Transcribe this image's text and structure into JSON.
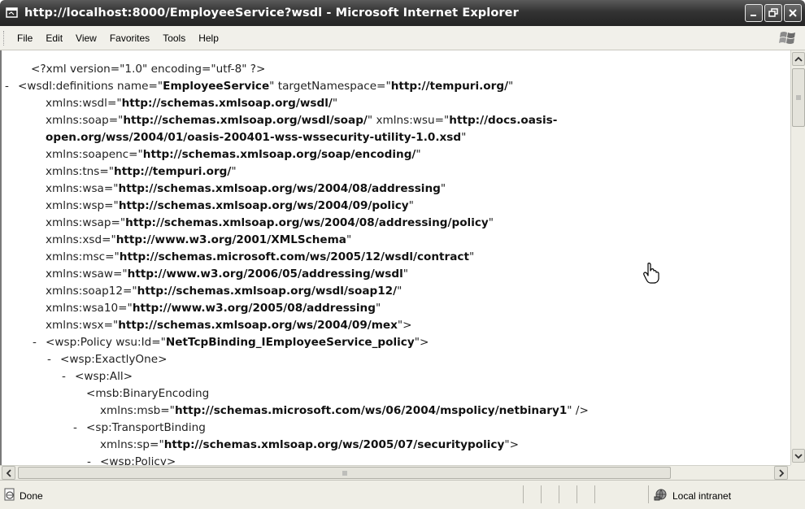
{
  "window": {
    "title": "http://localhost:8000/EmployeeService?wsdl - Microsoft Internet Explorer"
  },
  "menu": {
    "items": [
      "File",
      "Edit",
      "View",
      "Favorites",
      "Tools",
      "Help"
    ]
  },
  "xml_lines": [
    {
      "indent": 36,
      "toggle": "",
      "parts": [
        {
          "t": "<?xml version=\"1.0\" encoding=\"utf-8\" ?>"
        }
      ]
    },
    {
      "indent": 20,
      "toggle": "-",
      "parts": [
        {
          "t": "<wsdl:definitions name=\""
        },
        {
          "t": "EmployeeService",
          "b": true
        },
        {
          "t": "\" targetNamespace=\""
        },
        {
          "t": "http://tempuri.org/",
          "b": true
        },
        {
          "t": "\""
        }
      ]
    },
    {
      "indent": 54,
      "toggle": "",
      "parts": [
        {
          "t": "xmlns:wsdl=\""
        },
        {
          "t": "http://schemas.xmlsoap.org/wsdl/",
          "b": true
        },
        {
          "t": "\""
        }
      ]
    },
    {
      "indent": 54,
      "toggle": "",
      "parts": [
        {
          "t": "xmlns:soap=\""
        },
        {
          "t": "http://schemas.xmlsoap.org/wsdl/soap/",
          "b": true
        },
        {
          "t": "\" xmlns:wsu=\""
        },
        {
          "t": "http://docs.oasis-",
          "b": true
        }
      ]
    },
    {
      "indent": 54,
      "toggle": "",
      "parts": [
        {
          "t": "open.org/wss/2004/01/oasis-200401-wss-wssecurity-utility-1.0.xsd",
          "b": true
        },
        {
          "t": "\""
        }
      ]
    },
    {
      "indent": 54,
      "toggle": "",
      "parts": [
        {
          "t": "xmlns:soapenc=\""
        },
        {
          "t": "http://schemas.xmlsoap.org/soap/encoding/",
          "b": true
        },
        {
          "t": "\""
        }
      ]
    },
    {
      "indent": 54,
      "toggle": "",
      "parts": [
        {
          "t": "xmlns:tns=\""
        },
        {
          "t": "http://tempuri.org/",
          "b": true
        },
        {
          "t": "\""
        }
      ]
    },
    {
      "indent": 54,
      "toggle": "",
      "parts": [
        {
          "t": "xmlns:wsa=\""
        },
        {
          "t": "http://schemas.xmlsoap.org/ws/2004/08/addressing",
          "b": true
        },
        {
          "t": "\""
        }
      ]
    },
    {
      "indent": 54,
      "toggle": "",
      "parts": [
        {
          "t": "xmlns:wsp=\""
        },
        {
          "t": "http://schemas.xmlsoap.org/ws/2004/09/policy",
          "b": true
        },
        {
          "t": "\""
        }
      ]
    },
    {
      "indent": 54,
      "toggle": "",
      "parts": [
        {
          "t": "xmlns:wsap=\""
        },
        {
          "t": "http://schemas.xmlsoap.org/ws/2004/08/addressing/policy",
          "b": true
        },
        {
          "t": "\""
        }
      ]
    },
    {
      "indent": 54,
      "toggle": "",
      "parts": [
        {
          "t": "xmlns:xsd=\""
        },
        {
          "t": "http://www.w3.org/2001/XMLSchema",
          "b": true
        },
        {
          "t": "\""
        }
      ]
    },
    {
      "indent": 54,
      "toggle": "",
      "parts": [
        {
          "t": "xmlns:msc=\""
        },
        {
          "t": "http://schemas.microsoft.com/ws/2005/12/wsdl/contract",
          "b": true
        },
        {
          "t": "\""
        }
      ]
    },
    {
      "indent": 54,
      "toggle": "",
      "parts": [
        {
          "t": "xmlns:wsaw=\""
        },
        {
          "t": "http://www.w3.org/2006/05/addressing/wsdl",
          "b": true
        },
        {
          "t": "\""
        }
      ]
    },
    {
      "indent": 54,
      "toggle": "",
      "parts": [
        {
          "t": "xmlns:soap12=\""
        },
        {
          "t": "http://schemas.xmlsoap.org/wsdl/soap12/",
          "b": true
        },
        {
          "t": "\""
        }
      ]
    },
    {
      "indent": 54,
      "toggle": "",
      "parts": [
        {
          "t": "xmlns:wsa10=\""
        },
        {
          "t": "http://www.w3.org/2005/08/addressing",
          "b": true
        },
        {
          "t": "\""
        }
      ]
    },
    {
      "indent": 54,
      "toggle": "",
      "parts": [
        {
          "t": "xmlns:wsx=\""
        },
        {
          "t": "http://schemas.xmlsoap.org/ws/2004/09/mex",
          "b": true
        },
        {
          "t": "\">"
        }
      ]
    },
    {
      "indent": 54,
      "toggle": "-",
      "parts": [
        {
          "t": "<wsp:Policy wsu:Id=\""
        },
        {
          "t": "NetTcpBinding_IEmployeeService_policy",
          "b": true
        },
        {
          "t": "\">"
        }
      ]
    },
    {
      "indent": 72,
      "toggle": "-",
      "parts": [
        {
          "t": "<wsp:ExactlyOne>"
        }
      ]
    },
    {
      "indent": 90,
      "toggle": "-",
      "parts": [
        {
          "t": "<wsp:All>"
        }
      ]
    },
    {
      "indent": 104,
      "toggle": "",
      "parts": [
        {
          "t": "<msb:BinaryEncoding"
        }
      ]
    },
    {
      "indent": 121,
      "toggle": "",
      "parts": [
        {
          "t": "xmlns:msb=\""
        },
        {
          "t": "http://schemas.microsoft.com/ws/06/2004/mspolicy/netbinary1",
          "b": true
        },
        {
          "t": "\" />"
        }
      ]
    },
    {
      "indent": 104,
      "toggle": "-",
      "parts": [
        {
          "t": "<sp:TransportBinding"
        }
      ]
    },
    {
      "indent": 121,
      "toggle": "",
      "parts": [
        {
          "t": "xmlns:sp=\""
        },
        {
          "t": "http://schemas.xmlsoap.org/ws/2005/07/securitypolicy",
          "b": true
        },
        {
          "t": "\">"
        }
      ]
    },
    {
      "indent": 121,
      "toggle": "-",
      "parts": [
        {
          "t": "<wsp:Policy>"
        }
      ]
    }
  ],
  "status": {
    "text": "Done",
    "zone": "Local intranet"
  },
  "colors": {
    "titlebar": "#333333",
    "menubar": "#f1f0ea",
    "statusbar": "#efeee6"
  }
}
